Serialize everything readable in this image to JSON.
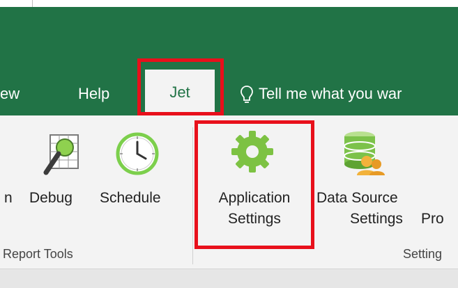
{
  "tabs": {
    "view": "ew",
    "help": "Help",
    "jet": "Jet"
  },
  "tell_me": "Tell me what you war",
  "ribbon": {
    "buttons": {
      "partial": "n",
      "debug": "Debug",
      "schedule": "Schedule",
      "app_settings_line1": "Application",
      "app_settings_line2": "Settings",
      "data_source_line1": "Data Source",
      "data_source_line2": "Settings",
      "partial_right": "Pro"
    },
    "groups": {
      "report_tools": "Report Tools",
      "settings": "Setting"
    }
  },
  "colors": {
    "excel_green": "#217346",
    "highlight": "#e8101b",
    "ribbon_bg": "#f3f3f3"
  },
  "icons": [
    "debug-icon",
    "schedule-clock-icon",
    "application-settings-gear-icon",
    "data-source-database-icon",
    "lightbulb-icon"
  ]
}
